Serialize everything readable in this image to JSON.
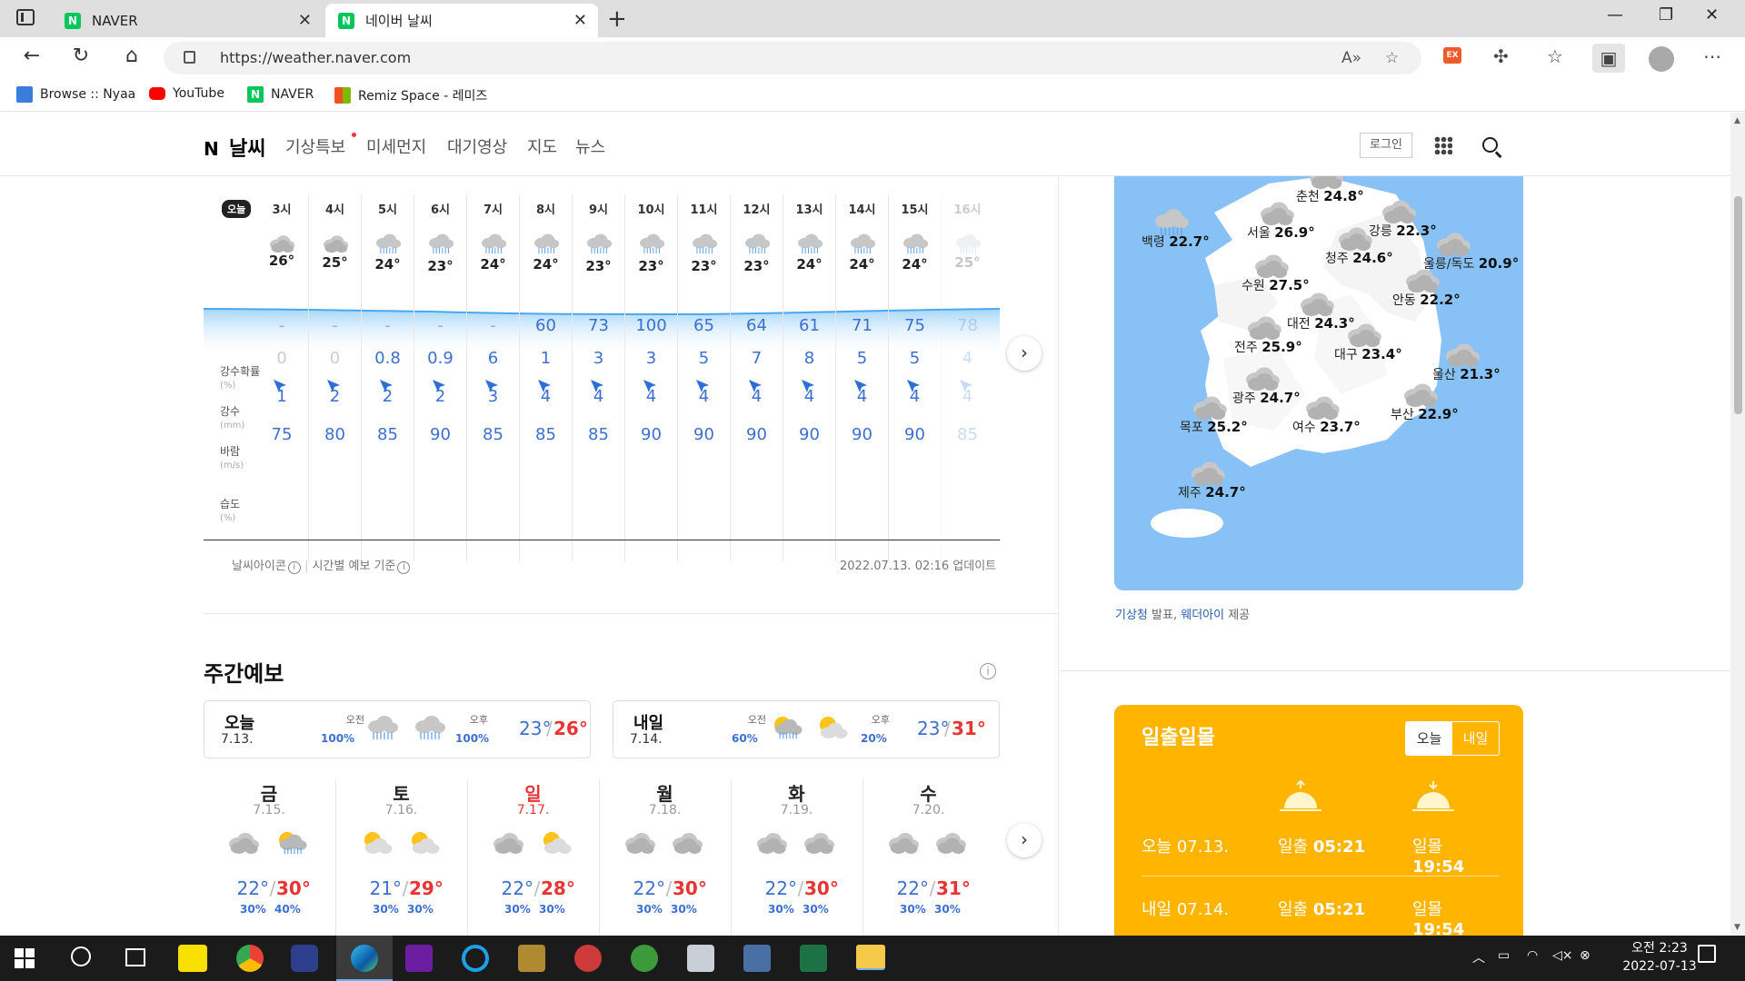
{
  "browser": {
    "tabs": [
      {
        "title": "NAVER",
        "active": false
      },
      {
        "title": "네이버 날씨",
        "active": true
      }
    ],
    "url": "https://weather.naver.com",
    "bookmarks": [
      "Browse :: Nyaa",
      "YouTube",
      "NAVER",
      "Remiz Space - 레미즈"
    ],
    "ext_label": "EX"
  },
  "gnb": {
    "logo_n": "N",
    "logo_text": "날씨",
    "menu": [
      "기상특보",
      "미세먼지",
      "대기영상",
      "지도",
      "뉴스"
    ],
    "login": "로그인"
  },
  "hourly": {
    "today_badge": "오늘",
    "labels": {
      "precip_prob": "강수확률",
      "precip_prob_unit": "(%)",
      "precip": "강수",
      "precip_unit": "(mm)",
      "wind": "바람",
      "wind_unit": "(m/s)",
      "humidity": "습도",
      "humidity_unit": "(%)"
    },
    "columns": [
      {
        "time": "3시",
        "icon": "cloudy-icon",
        "temp": "26°",
        "prob": "-",
        "precip": "0",
        "wind": "1",
        "humidity": "75"
      },
      {
        "time": "4시",
        "icon": "cloudy-icon",
        "temp": "25°",
        "prob": "-",
        "precip": "0",
        "wind": "2",
        "humidity": "80"
      },
      {
        "time": "5시",
        "icon": "rain-icon",
        "temp": "24°",
        "prob": "-",
        "precip": "0.8",
        "wind": "2",
        "humidity": "85"
      },
      {
        "time": "6시",
        "icon": "rain-icon",
        "temp": "23°",
        "prob": "-",
        "precip": "0.9",
        "wind": "2",
        "humidity": "90"
      },
      {
        "time": "7시",
        "icon": "rain-icon",
        "temp": "24°",
        "prob": "-",
        "precip": "6",
        "wind": "3",
        "humidity": "85"
      },
      {
        "time": "8시",
        "icon": "rain-icon",
        "temp": "24°",
        "prob": "60",
        "precip": "1",
        "wind": "4",
        "humidity": "85"
      },
      {
        "time": "9시",
        "icon": "rain-icon",
        "temp": "23°",
        "prob": "73",
        "precip": "3",
        "wind": "4",
        "humidity": "85"
      },
      {
        "time": "10시",
        "icon": "rain-icon",
        "temp": "23°",
        "prob": "100",
        "precip": "3",
        "wind": "4",
        "humidity": "90"
      },
      {
        "time": "11시",
        "icon": "rain-icon",
        "temp": "23°",
        "prob": "65",
        "precip": "5",
        "wind": "4",
        "humidity": "90"
      },
      {
        "time": "12시",
        "icon": "rain-icon",
        "temp": "23°",
        "prob": "64",
        "precip": "7",
        "wind": "4",
        "humidity": "90"
      },
      {
        "time": "13시",
        "icon": "rain-icon",
        "temp": "24°",
        "prob": "61",
        "precip": "8",
        "wind": "4",
        "humidity": "90"
      },
      {
        "time": "14시",
        "icon": "rain-icon",
        "temp": "24°",
        "prob": "71",
        "precip": "5",
        "wind": "4",
        "humidity": "90"
      },
      {
        "time": "15시",
        "icon": "rain-icon",
        "temp": "24°",
        "prob": "75",
        "precip": "5",
        "wind": "4",
        "humidity": "90"
      },
      {
        "time": "16시",
        "icon": "rain-icon",
        "temp": "25°",
        "prob": "78",
        "precip": "4",
        "wind": "4",
        "humidity": "85"
      }
    ],
    "footnote_icons": "날씨아이콘",
    "footnote_basis": "시간별 예보 기준",
    "updated": "2022.07.13. 02:16 업데이트"
  },
  "weekly": {
    "title": "주간예보",
    "cards": [
      {
        "day": "오늘",
        "date": "7.13.",
        "am_label": "오전",
        "am_pct": "100%",
        "am_icon": "rain-icon",
        "pm_label": "오후",
        "pm_pct": "100%",
        "pm_icon": "rain-icon",
        "lo": "23°",
        "hi": "26°"
      },
      {
        "day": "내일",
        "date": "7.14.",
        "am_label": "오전",
        "am_pct": "60%",
        "am_icon": "sun-rain-icon",
        "pm_label": "오후",
        "pm_pct": "20%",
        "pm_icon": "partly-cloudy-icon",
        "lo": "23°",
        "hi": "31°"
      }
    ],
    "days": [
      {
        "wd": "금",
        "date": "7.15.",
        "red": false,
        "icons": [
          "cloudy-icon",
          "sun-rain-icon"
        ],
        "lo": "22°",
        "hi": "30°",
        "am_pct": "30%",
        "pm_pct": "40%"
      },
      {
        "wd": "토",
        "date": "7.16.",
        "red": false,
        "icons": [
          "partly-cloudy-icon",
          "partly-cloudy-icon"
        ],
        "lo": "21°",
        "hi": "29°",
        "am_pct": "30%",
        "pm_pct": "30%"
      },
      {
        "wd": "일",
        "date": "7.17.",
        "red": true,
        "icons": [
          "cloudy-icon",
          "partly-cloudy-icon"
        ],
        "lo": "22°",
        "hi": "28°",
        "am_pct": "30%",
        "pm_pct": "30%"
      },
      {
        "wd": "월",
        "date": "7.18.",
        "red": false,
        "icons": [
          "cloudy-icon",
          "cloudy-icon"
        ],
        "lo": "22°",
        "hi": "30°",
        "am_pct": "30%",
        "pm_pct": "30%"
      },
      {
        "wd": "화",
        "date": "7.19.",
        "red": false,
        "icons": [
          "cloudy-icon",
          "cloudy-icon"
        ],
        "lo": "22°",
        "hi": "30°",
        "am_pct": "30%",
        "pm_pct": "30%"
      },
      {
        "wd": "수",
        "date": "7.20.",
        "red": false,
        "icons": [
          "cloudy-icon",
          "cloudy-icon"
        ],
        "lo": "22°",
        "hi": "31°",
        "am_pct": "30%",
        "pm_pct": "30%"
      }
    ]
  },
  "map": {
    "cities": [
      {
        "name": "춘천",
        "temp": "24.8°"
      },
      {
        "name": "백령",
        "temp": "22.7°"
      },
      {
        "name": "서울",
        "temp": "26.9°"
      },
      {
        "name": "강릉",
        "temp": "22.3°"
      },
      {
        "name": "청주",
        "temp": "24.6°"
      },
      {
        "name": "울릉/독도",
        "temp": "20.9°"
      },
      {
        "name": "수원",
        "temp": "27.5°"
      },
      {
        "name": "안동",
        "temp": "22.2°"
      },
      {
        "name": "대전",
        "temp": "24.3°"
      },
      {
        "name": "전주",
        "temp": "25.9°"
      },
      {
        "name": "대구",
        "temp": "23.4°"
      },
      {
        "name": "울산",
        "temp": "21.3°"
      },
      {
        "name": "광주",
        "temp": "24.7°"
      },
      {
        "name": "목포",
        "temp": "25.2°"
      },
      {
        "name": "여수",
        "temp": "23.7°"
      },
      {
        "name": "부산",
        "temp": "22.9°"
      },
      {
        "name": "제주",
        "temp": "24.7°"
      }
    ],
    "credit_kma": "기상청",
    "credit_mid": "발표,",
    "credit_weatheri": "웨더아이",
    "credit_end": "제공"
  },
  "sun": {
    "title": "일출일몰",
    "toggle_today": "오늘",
    "toggle_tomorrow": "내일",
    "rows": [
      {
        "label": "오늘 07.13.",
        "rise_label": "일출",
        "rise": "05:21",
        "set_label": "일몰",
        "set": "19:54"
      },
      {
        "label": "내일 07.14.",
        "rise_label": "일출",
        "rise": "05:21",
        "set_label": "일몰",
        "set": "19:54"
      }
    ]
  },
  "taskbar": {
    "clock_line1": "오전 2:23",
    "clock_line2": "2022-07-13"
  }
}
